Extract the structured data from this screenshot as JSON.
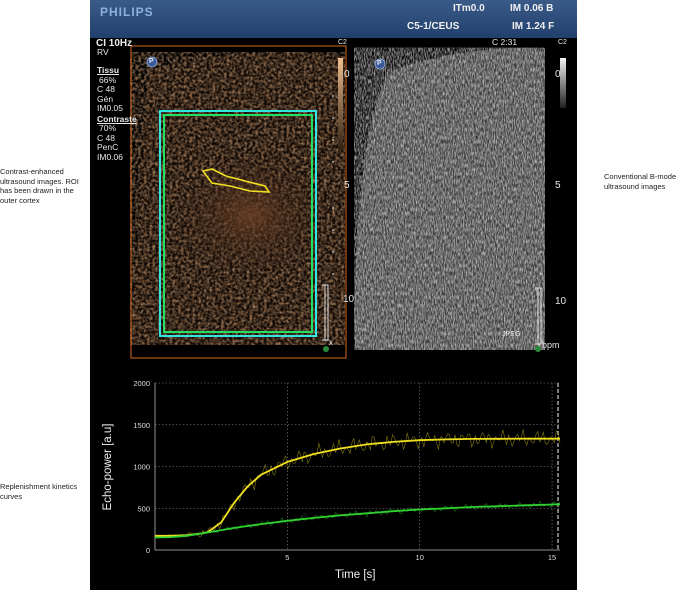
{
  "annotations": {
    "contrast_note": "Contrast-enhanced ultrasound images. ROI has been drawn in the outer cortex",
    "bmode_note": "Conventional B-mode ultrasound images",
    "curves_note": "Replenishment kinetics curves"
  },
  "scanner": {
    "brand": "PHILIPS",
    "itm": "ITm0.0",
    "im_b": "IM 0.06 B",
    "probe": "C5-1/CEUS",
    "im_f": "IM 1.24 F",
    "mode": "CI 10Hz",
    "rv": "RV",
    "c2_left": "C2",
    "c2_right": "C2",
    "clock": "C 2:31",
    "tissue_heading": "Tissu",
    "tissue_lines": [
      "66%",
      "C 48",
      "Gén",
      "IM0.05"
    ],
    "contrast_heading": "Contraste",
    "contrast_lines": [
      "70%",
      "C 48",
      "PenC",
      "IM0.06"
    ],
    "depth_left": [
      "0",
      "5",
      "10"
    ],
    "depth_right": [
      "0",
      "5",
      "10"
    ],
    "x_marker": "x",
    "jpeg": "JPEG",
    "bpm": "bpm",
    "p_icon_label": "P",
    "colors": {
      "roi_green": "#22e060",
      "roi_cyan": "#30e8e0",
      "contour_yellow": "#f0e020",
      "frame_orange": "#d86a20"
    }
  },
  "chart_data": {
    "type": "line",
    "xlabel": "Time [s]",
    "ylabel": "Echo-power [a.u]",
    "xlim": [
      0,
      15.3
    ],
    "ylim": [
      0,
      2000
    ],
    "xticks": [
      5,
      10,
      15
    ],
    "yticks": [
      0,
      500,
      1000,
      1500,
      2000
    ],
    "grid": true,
    "series": [
      {
        "color": "#f0e020",
        "x": [
          0.0,
          0.6,
          1.2,
          1.8,
          2.0,
          2.5,
          3.0,
          3.5,
          4.0,
          5.0,
          6.0,
          7.0,
          8.0,
          9.0,
          10.0,
          11.0,
          12.0,
          13.0,
          14.0,
          15.0,
          15.3
        ],
        "y": [
          170,
          170,
          178,
          200,
          215,
          330,
          570,
          760,
          900,
          1055,
          1150,
          1215,
          1265,
          1295,
          1315,
          1325,
          1330,
          1332,
          1333,
          1333,
          1333
        ]
      },
      {
        "color": "#30d030",
        "x": [
          0.0,
          0.6,
          1.2,
          2.0,
          3.0,
          4.0,
          5.0,
          6.0,
          7.0,
          8.0,
          9.0,
          10.0,
          11.0,
          12.0,
          13.0,
          14.0,
          15.0,
          15.3
        ],
        "y": [
          150,
          155,
          170,
          210,
          265,
          310,
          350,
          385,
          415,
          440,
          465,
          485,
          500,
          515,
          525,
          535,
          545,
          548
        ]
      }
    ]
  }
}
